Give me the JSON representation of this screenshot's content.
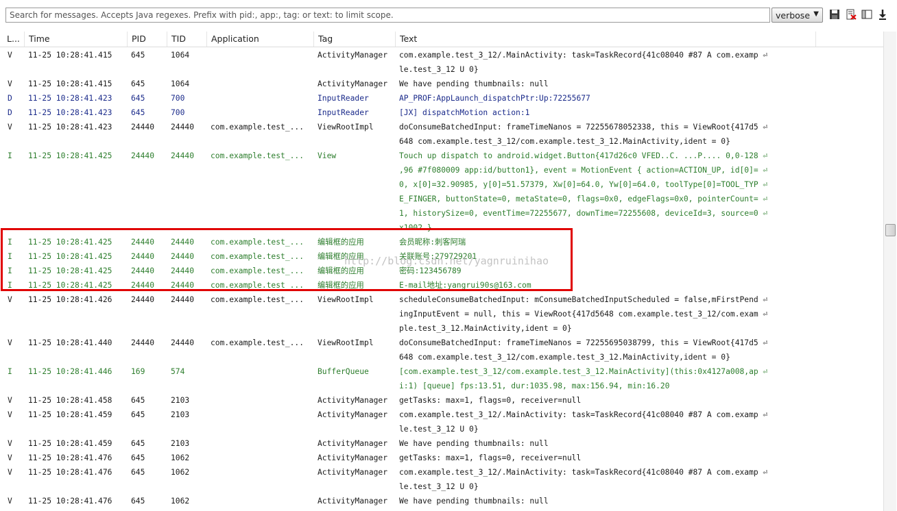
{
  "search": {
    "placeholder": "Search for messages. Accepts Java regexes. Prefix with pid:, app:, tag: or text: to limit scope.",
    "value": ""
  },
  "level_select": {
    "value": "verbose"
  },
  "toolbar_icons": [
    "save-icon",
    "clear-log-icon",
    "toggle-panel-icon",
    "scroll-lock-icon"
  ],
  "columns": [
    "L...",
    "Time",
    "PID",
    "TID",
    "Application",
    "Tag",
    "Text"
  ],
  "colors": {
    "verbose": "#1a1a1a",
    "debug": "#1a2a8a",
    "info": "#2c7d2c",
    "highlight": "#e00000"
  },
  "watermark": "http://blog.csdn.net/yagnruinihao",
  "rows": [
    {
      "level": "V",
      "time": "11-25 10:28:41.415",
      "pid": "645",
      "tid": "1064",
      "app": "",
      "tag": "ActivityManager",
      "text": [
        "com.example.test_3_12/.MainActivity: task=TaskRecord{41c08040 #87 A com.examp ⏎",
        "le.test_3_12 U 0}"
      ]
    },
    {
      "level": "V",
      "time": "11-25 10:28:41.415",
      "pid": "645",
      "tid": "1064",
      "app": "",
      "tag": "ActivityManager",
      "text": [
        "We have pending thumbnails: null"
      ]
    },
    {
      "level": "D",
      "time": "11-25 10:28:41.423",
      "pid": "645",
      "tid": "700",
      "app": "",
      "tag": "InputReader",
      "text": [
        "AP_PROF:AppLaunch_dispatchPtr:Up:72255677"
      ]
    },
    {
      "level": "D",
      "time": "11-25 10:28:41.423",
      "pid": "645",
      "tid": "700",
      "app": "",
      "tag": "InputReader",
      "text": [
        "[JX] dispatchMotion action:1"
      ]
    },
    {
      "level": "V",
      "time": "11-25 10:28:41.423",
      "pid": "24440",
      "tid": "24440",
      "app": "com.example.test_...",
      "tag": "ViewRootImpl",
      "text": [
        "doConsumeBatchedInput: frameTimeNanos = 72255678052338, this = ViewRoot{417d5 ⏎",
        "648 com.example.test_3_12/com.example.test_3_12.MainActivity,ident = 0}"
      ]
    },
    {
      "level": "I",
      "time": "11-25 10:28:41.425",
      "pid": "24440",
      "tid": "24440",
      "app": "com.example.test_...",
      "tag": "View",
      "text": [
        "Touch up dispatch to android.widget.Button{417d26c0 VFED..C. ...P.... 0,0-128 ⏎",
        ",96 #7f080009 app:id/button1}, event = MotionEvent { action=ACTION_UP, id[0]= ⏎",
        "0, x[0]=32.90985, y[0]=51.57379, Xw[0]=64.0, Yw[0]=64.0, toolType[0]=TOOL_TYP ⏎",
        "E_FINGER, buttonState=0, metaState=0, flags=0x0, edgeFlags=0x0, pointerCount= ⏎",
        "1, historySize=0, eventTime=72255677, downTime=72255608, deviceId=3, source=0 ⏎",
        "x1002 }"
      ]
    },
    {
      "level": "I",
      "time": "11-25 10:28:41.425",
      "pid": "24440",
      "tid": "24440",
      "app": "com.example.test_...",
      "tag": "编辑框的应用",
      "text": [
        "会员昵称:刺客阿瑞"
      ]
    },
    {
      "level": "I",
      "time": "11-25 10:28:41.425",
      "pid": "24440",
      "tid": "24440",
      "app": "com.example.test_...",
      "tag": "编辑框的应用",
      "text": [
        "关联账号:279729201"
      ]
    },
    {
      "level": "I",
      "time": "11-25 10:28:41.425",
      "pid": "24440",
      "tid": "24440",
      "app": "com.example.test_...",
      "tag": "编辑框的应用",
      "text": [
        "密码:123456789"
      ]
    },
    {
      "level": "I",
      "time": "11-25 10:28:41.425",
      "pid": "24440",
      "tid": "24440",
      "app": "com.example.test_...",
      "tag": "编辑框的应用",
      "text": [
        "E-mail地址:yangrui90s@163.com"
      ]
    },
    {
      "level": "V",
      "time": "11-25 10:28:41.426",
      "pid": "24440",
      "tid": "24440",
      "app": "com.example.test_...",
      "tag": "ViewRootImpl",
      "text": [
        "scheduleConsumeBatchedInput: mConsumeBatchedInputScheduled = false,mFirstPend ⏎",
        "ingInputEvent = null, this = ViewRoot{417d5648 com.example.test_3_12/com.exam ⏎",
        "ple.test_3_12.MainActivity,ident = 0}"
      ]
    },
    {
      "level": "V",
      "time": "11-25 10:28:41.440",
      "pid": "24440",
      "tid": "24440",
      "app": "com.example.test_...",
      "tag": "ViewRootImpl",
      "text": [
        "doConsumeBatchedInput: frameTimeNanos = 72255695038799, this = ViewRoot{417d5 ⏎",
        "648 com.example.test_3_12/com.example.test_3_12.MainActivity,ident = 0}"
      ]
    },
    {
      "level": "I",
      "time": "11-25 10:28:41.446",
      "pid": "169",
      "tid": "574",
      "app": "",
      "tag": "BufferQueue",
      "text": [
        "[com.example.test_3_12/com.example.test_3_12.MainActivity](this:0x4127a008,ap ⏎",
        "i:1) [queue] fps:13.51, dur:1035.98, max:156.94, min:16.20"
      ]
    },
    {
      "level": "V",
      "time": "11-25 10:28:41.458",
      "pid": "645",
      "tid": "2103",
      "app": "",
      "tag": "ActivityManager",
      "text": [
        "getTasks: max=1, flags=0, receiver=null"
      ]
    },
    {
      "level": "V",
      "time": "11-25 10:28:41.459",
      "pid": "645",
      "tid": "2103",
      "app": "",
      "tag": "ActivityManager",
      "text": [
        "com.example.test_3_12/.MainActivity: task=TaskRecord{41c08040 #87 A com.examp ⏎",
        "le.test_3_12 U 0}"
      ]
    },
    {
      "level": "V",
      "time": "11-25 10:28:41.459",
      "pid": "645",
      "tid": "2103",
      "app": "",
      "tag": "ActivityManager",
      "text": [
        "We have pending thumbnails: null"
      ]
    },
    {
      "level": "V",
      "time": "11-25 10:28:41.476",
      "pid": "645",
      "tid": "1062",
      "app": "",
      "tag": "ActivityManager",
      "text": [
        "getTasks: max=1, flags=0, receiver=null"
      ]
    },
    {
      "level": "V",
      "time": "11-25 10:28:41.476",
      "pid": "645",
      "tid": "1062",
      "app": "",
      "tag": "ActivityManager",
      "text": [
        "com.example.test_3_12/.MainActivity: task=TaskRecord{41c08040 #87 A com.examp ⏎",
        "le.test_3_12 U 0}"
      ]
    },
    {
      "level": "V",
      "time": "11-25 10:28:41.476",
      "pid": "645",
      "tid": "1062",
      "app": "",
      "tag": "ActivityManager",
      "text": [
        "We have pending thumbnails: null"
      ]
    }
  ]
}
